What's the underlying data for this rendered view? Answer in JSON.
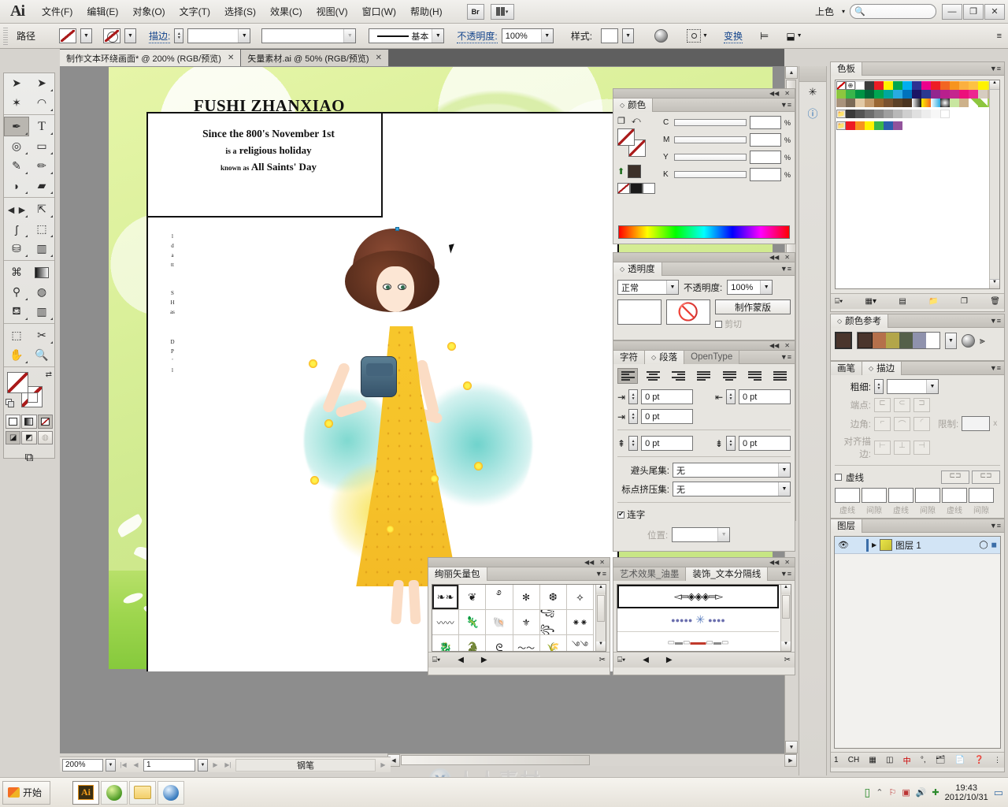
{
  "app": {
    "name": "Ai",
    "title": "Adobe Illustrator"
  },
  "menubar": {
    "items": [
      "文件(F)",
      "编辑(E)",
      "对象(O)",
      "文字(T)",
      "选择(S)",
      "效果(C)",
      "视图(V)",
      "窗口(W)",
      "帮助(H)"
    ],
    "bridge_label": "Br",
    "workspace_label": "上色",
    "search_placeholder": "",
    "window_buttons": {
      "minimize": "—",
      "restore": "❐",
      "close": "✕"
    }
  },
  "controlbar": {
    "object_type": "路径",
    "stroke_label": "描边:",
    "stroke_weight": "",
    "stroke_profile": "",
    "brush_definition": "基本",
    "opacity_label": "不透明度:",
    "opacity_value": "100%",
    "style_label": "样式:",
    "transform_label": "变换",
    "panel_menu": "≡"
  },
  "tabs": [
    {
      "label": "制作文本环绕画面* @ 200% (RGB/预览)",
      "close": "✕",
      "active": true
    },
    {
      "label": "矢量素材.ai @ 50% (RGB/预览)",
      "close": "✕",
      "active": false
    }
  ],
  "toolbox": {
    "tools": [
      {
        "name": "selection-tool",
        "glyph": "➤"
      },
      {
        "name": "direct-selection-tool",
        "glyph": "➤"
      },
      {
        "name": "magic-wand-tool",
        "glyph": "✨"
      },
      {
        "name": "lasso-tool",
        "glyph": "◠"
      },
      {
        "name": "pen-tool",
        "glyph": "✒",
        "selected": true
      },
      {
        "name": "type-tool",
        "glyph": "T"
      },
      {
        "name": "line-segment-tool",
        "glyph": "◎"
      },
      {
        "name": "rectangle-tool",
        "glyph": "▭"
      },
      {
        "name": "paintbrush-tool",
        "glyph": "🖌"
      },
      {
        "name": "pencil-tool",
        "glyph": "✏"
      },
      {
        "name": "blob-brush-tool",
        "glyph": "◖"
      },
      {
        "name": "eraser-tool",
        "glyph": "▰"
      },
      {
        "name": "rotate-tool",
        "glyph": "⟳"
      },
      {
        "name": "scale-tool",
        "glyph": "⤢"
      },
      {
        "name": "warp-tool",
        "glyph": "〜"
      },
      {
        "name": "free-transform-tool",
        "glyph": "⬚"
      },
      {
        "name": "symbol-sprayer-tool",
        "glyph": "⛁"
      },
      {
        "name": "column-graph-tool",
        "glyph": "▥"
      },
      {
        "name": "mesh-tool",
        "glyph": "⌗"
      },
      {
        "name": "gradient-tool",
        "glyph": "▤"
      },
      {
        "name": "eyedropper-tool",
        "glyph": "⚲"
      },
      {
        "name": "blend-tool",
        "glyph": "⬤"
      },
      {
        "name": "live-paint-bucket-tool",
        "glyph": "⛾"
      },
      {
        "name": "live-paint-selection-tool",
        "glyph": "▥"
      },
      {
        "name": "artboard-tool",
        "glyph": "⬚"
      },
      {
        "name": "slice-tool",
        "glyph": "🔪"
      },
      {
        "name": "hand-tool",
        "glyph": "✋"
      },
      {
        "name": "zoom-tool",
        "glyph": "🔍"
      }
    ],
    "fill_label": "fill",
    "stroke_label": "stroke",
    "screen_modes": [
      "normal-screen",
      "full-screen-menubar",
      "full-screen"
    ]
  },
  "document": {
    "heading": "FUSHI ZHANXIAO",
    "line1": "Since the 800's November 1st",
    "line2_small": "is a",
    "line2_big": "religious holiday",
    "line3_small": "known as",
    "line3_big": "All Saints' Day",
    "vertical_text": [
      "l",
      "d",
      "a",
      "tt",
      "S",
      "H",
      "as",
      "D",
      "P",
      "'",
      "l"
    ]
  },
  "statusbar": {
    "zoom": "200%",
    "page": "1",
    "tool": "钢笔"
  },
  "panels": {
    "color": {
      "title": "颜色",
      "channels": [
        {
          "label": "C",
          "value": ""
        },
        {
          "label": "M",
          "value": ""
        },
        {
          "label": "Y",
          "value": ""
        },
        {
          "label": "K",
          "value": ""
        }
      ],
      "percent_symbol": "%"
    },
    "transparency": {
      "title": "透明度",
      "blend_mode": "正常",
      "opacity_label": "不透明度:",
      "opacity_value": "100%",
      "make_mask_button": "制作蒙版",
      "clip_label": "剪切"
    },
    "paragraph": {
      "tabs": [
        "字符",
        "段落",
        "OpenType"
      ],
      "active_tab": "段落",
      "indent_left": "0 pt",
      "indent_right": "0 pt",
      "indent_first": "0 pt",
      "space_before": "0 pt",
      "space_after": "0 pt",
      "kinsoku_label": "避头尾集:",
      "kinsoku_value": "无",
      "burasagari_label": "标点挤压集:",
      "burasagari_value": "无",
      "hyphenate_label": "连字",
      "hyphenate_checked": true,
      "position_label": "位置:",
      "position_value": ""
    },
    "swatches": {
      "title": "色板",
      "rows": [
        [
          "none",
          "registration",
          "#ffffff",
          "#3b3b3b",
          "#ec1c24",
          "#fff200",
          "#00a54f",
          "#00aeef",
          "#2e3192",
          "#ec008c",
          "#ed1c24",
          "#f26522",
          "#f7941e",
          "#fbb040"
        ],
        [
          "#fdc243",
          "#fff200",
          "#eeea2a",
          "#8dc63f",
          "#39b54a",
          "#009444",
          "#006838",
          "#00a651",
          "#00a79d",
          "#29abe2",
          "#0072bc",
          "#1b1464",
          "#2b3990",
          "#92278f"
        ],
        [
          "#b81f8d",
          "#c4268e",
          "#ec0f7b",
          "#ed2590",
          "#d6ccc0",
          "#c3b49e",
          "#a9937c",
          "#7b6a56",
          "#e2c9a6",
          "#c49a6c",
          "#996633",
          "#7a5230",
          "#5c4127",
          "#4a3420"
        ],
        [
          "grad-gray",
          "grad-yellow",
          "grad-blue",
          "radial",
          "pattern-green",
          "pattern-tan",
          "line-green",
          "line-green2",
          "#a5d154"
        ],
        [
          "folder",
          "#3b3b3b",
          "#545454",
          "#6d6d6d",
          "#868686",
          "#9f9f9f",
          "#b8b8b8",
          "#cfcfcf",
          "#e0e0e0",
          "#ededed",
          "#f7f7f7",
          "#ffffff"
        ],
        [
          "folder",
          "#ed1c24",
          "#f7941e",
          "#fff200",
          "#39b54a",
          "#2b5fad",
          "#92539c"
        ]
      ],
      "footer_icons": [
        "swatch-libraries",
        "show-swatch-kinds",
        "swatch-options",
        "new-color-group",
        "new-swatch",
        "delete-swatch"
      ]
    },
    "color_guide": {
      "title": "颜色参考",
      "harmony_colors": [
        "#4a352c",
        "#b5704b",
        "#b3a64a",
        "#55604a",
        "#8f92ad"
      ],
      "footer_icons": [
        "limit-color-group",
        "edit-colors"
      ]
    },
    "stroke": {
      "tabs": [
        "画笔",
        "描边"
      ],
      "active_tab": "描边",
      "weight_label": "粗细:",
      "weight_value": "",
      "cap_label": "端点:",
      "corner_label": "边角:",
      "limit_label": "限制:",
      "limit_value": "",
      "limit_unit": "x",
      "align_label": "对齐描边:",
      "dashed_label": "虚线",
      "dash_fields": [
        "虚线",
        "间隙",
        "虚线",
        "间隙",
        "虚线",
        "间隙"
      ]
    },
    "layers": {
      "title": "图层",
      "rows": [
        {
          "name": "图层 1",
          "visible": true,
          "locked": false,
          "selected": true
        }
      ],
      "count": "1",
      "footer_icons": [
        "locate-object",
        "make-clipping-mask",
        "create-new-sublayer",
        "create-new-layer",
        "delete-selection"
      ]
    },
    "symbols_left": {
      "title": "绚丽矢量包",
      "cells": 18,
      "selected_index": 0,
      "footer_icons": [
        "symbol-libraries-menu",
        "previous",
        "next",
        "break-link"
      ]
    },
    "brushes_right": {
      "tabs": [
        "艺术效果_油墨",
        "装饰_文本分隔线"
      ],
      "active_tab": "装饰_文本分隔线",
      "items": [
        "ornate-divider-1",
        "beads-divider-2",
        "ribbon-divider-3"
      ],
      "selected_index": 0,
      "footer_icons": [
        "brush-libraries-menu",
        "previous",
        "next",
        "remove-brush-stroke"
      ]
    }
  },
  "taskbar": {
    "start_label": "开始",
    "apps": [
      "illustrator-icon",
      "browser-icon",
      "folder-icon",
      "browser2-icon"
    ],
    "tray_icons": [
      "usb-icon",
      "expand-icon",
      "network-icon",
      "shield-icon",
      "volume-icon",
      "update-icon"
    ],
    "time": "19:43",
    "date": "2012/10/31"
  },
  "watermark": {
    "logo": "M",
    "text": "人人素材"
  }
}
